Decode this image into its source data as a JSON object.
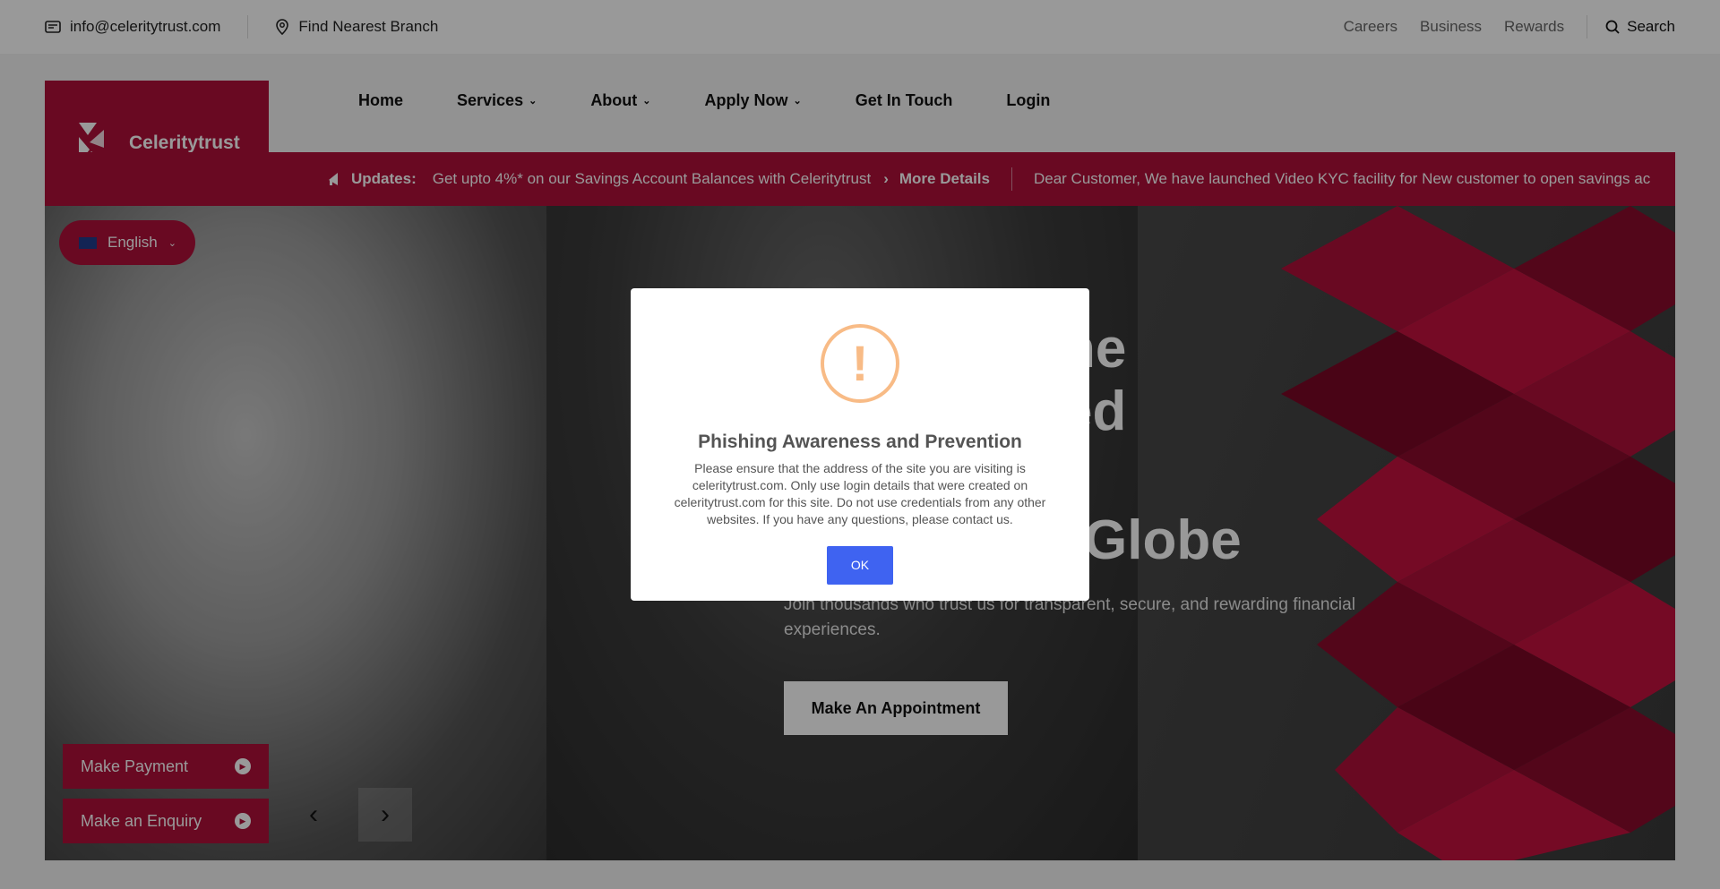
{
  "topbar": {
    "email": "info@celeritytrust.com",
    "branch": "Find Nearest Branch",
    "links": [
      "Careers",
      "Business",
      "Rewards"
    ],
    "search": "Search"
  },
  "brand": {
    "name": "Celeritytrust",
    "color": "#b0103a"
  },
  "nav": {
    "home": "Home",
    "services": "Services",
    "about": "About",
    "apply": "Apply Now",
    "contact": "Get In Touch",
    "login": "Login"
  },
  "updates": {
    "label": "Updates:",
    "message1": "Get upto 4%* on our Savings Account Balances with  Celeritytrust",
    "more": "More Details",
    "message2": "Dear Customer, We have launched Video KYC facility for New customer to open savings ac"
  },
  "language": {
    "selected": "English"
  },
  "hero": {
    "line1": "ne",
    "line2": "ed",
    "line3": "Globe",
    "subtitle": "Join thousands who trust us for transparent, secure, and rewarding financial experiences.",
    "cta": "Make An Appointment"
  },
  "side_buttons": {
    "payment": "Make Payment",
    "enquiry": "Make an Enquiry"
  },
  "modal": {
    "icon": "!",
    "title": "Phishing Awareness and Prevention",
    "body": "Please ensure that the address of the site you are visiting is celeritytrust.com. Only use login details that were created on celeritytrust.com for this site. Do not use credentials from any other websites. If you have any questions, please contact us.",
    "ok": "OK",
    "button_color": "#3f63f1",
    "icon_color": "#f8bb86"
  }
}
